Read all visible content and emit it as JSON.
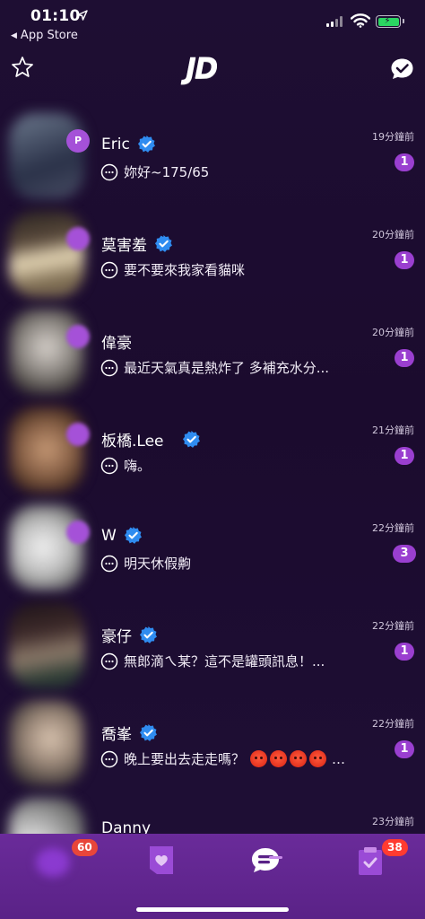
{
  "status_bar": {
    "time": "01:10",
    "back_app": "App Store",
    "battery_color": "#2bd562"
  },
  "header": {
    "logo": "JD",
    "left_icon": "star-icon",
    "right_icon": "check-bubble-icon"
  },
  "conversations": [
    {
      "name": "Eric",
      "verified": true,
      "message": "妳好~175/65",
      "time": "19分鐘前",
      "unread": "1",
      "avatar_colors": [
        "#3a3f5a",
        "#6d7a8e"
      ]
    },
    {
      "name": "莫害羞",
      "verified": true,
      "message": "要不要來我家看貓咪",
      "time": "20分鐘前",
      "unread": "1",
      "avatar_colors": [
        "#5a4a3c",
        "#e8d9b8"
      ]
    },
    {
      "name": "偉豪",
      "verified": false,
      "message": "最近天氣真是熱炸了 多補充水分...",
      "time": "20分鐘前",
      "unread": "1",
      "avatar_colors": [
        "#6b6b6b",
        "#c9c3bd"
      ]
    },
    {
      "name": "板橋.Lee",
      "verified": true,
      "message": "嗨。",
      "time": "21分鐘前",
      "unread": "1",
      "avatar_colors": [
        "#6e4a33",
        "#c79a76"
      ]
    },
    {
      "name": "W",
      "verified": true,
      "message": "明天休假齁",
      "time": "22分鐘前",
      "unread": "3",
      "avatar_colors": [
        "#8a8a8a",
        "#e6e6e6"
      ]
    },
    {
      "name": "豪仔",
      "verified": true,
      "message": "無郎滴ㄟ某？這不是罐頭訊息！...",
      "time": "22分鐘前",
      "unread": "1",
      "avatar_colors": [
        "#3d2a2a",
        "#8c7a6a"
      ]
    },
    {
      "name": "喬峯",
      "verified": true,
      "message": "晚上要出去走走嗎？",
      "time": "22分鐘前",
      "unread": "1",
      "avatar_colors": [
        "#4a4a4a",
        "#d9c4b0"
      ]
    },
    {
      "name": "Danny",
      "verified": false,
      "message": "",
      "time": "23分鐘前",
      "unread": "",
      "avatar_colors": [
        "#777777",
        "#eeeeee"
      ]
    }
  ],
  "tab_bar": {
    "home_badge": "60",
    "tasks_badge": "38",
    "active_tab": "chat"
  }
}
